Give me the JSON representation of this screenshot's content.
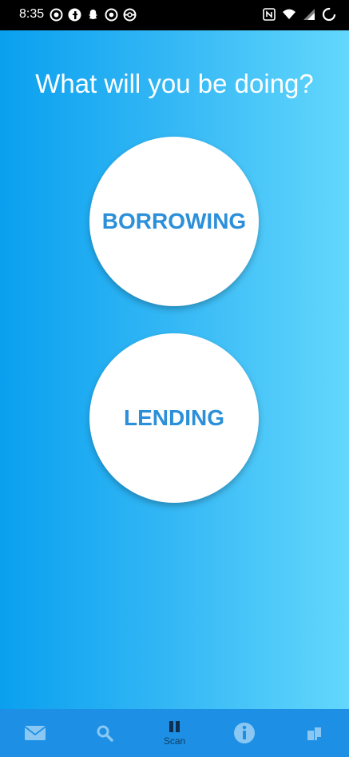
{
  "status_bar": {
    "time": "8:35",
    "notification_icons": [
      "whatsapp-icon",
      "facebook-icon",
      "snapchat-icon",
      "chrome-icon",
      "pokeball-icon"
    ],
    "system_icons": [
      "nfc-icon",
      "wifi-icon",
      "signal-icon",
      "battery-icon"
    ]
  },
  "main": {
    "prompt": "What will you be doing?",
    "borrow_label": "BORROWING",
    "lend_label": "LENDING"
  },
  "bottom_nav": {
    "items": [
      {
        "icon": "mail-icon",
        "label": ""
      },
      {
        "icon": "search-icon",
        "label": ""
      },
      {
        "icon": "barcode-icon",
        "label": "Scan"
      },
      {
        "icon": "info-icon",
        "label": ""
      },
      {
        "icon": "profile-icon",
        "label": ""
      }
    ]
  },
  "colors": {
    "gradient_left": "#0aa0ef",
    "gradient_right": "#63d7fc",
    "button_text": "#2b8fd9",
    "nav_bg": "#1d90e6"
  }
}
